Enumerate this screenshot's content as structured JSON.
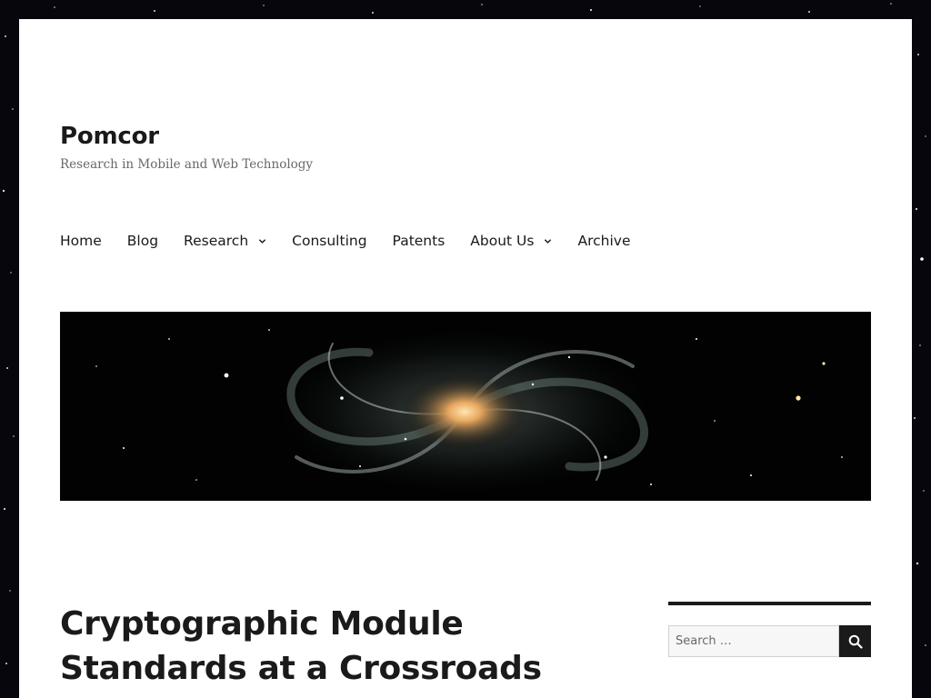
{
  "site": {
    "title": "Pomcor",
    "description": "Research in Mobile and Web Technology"
  },
  "nav": {
    "items": [
      {
        "label": "Home",
        "has_submenu": false
      },
      {
        "label": "Blog",
        "has_submenu": false
      },
      {
        "label": "Research",
        "has_submenu": true
      },
      {
        "label": "Consulting",
        "has_submenu": false
      },
      {
        "label": "Patents",
        "has_submenu": false
      },
      {
        "label": "About Us",
        "has_submenu": true
      },
      {
        "label": "Archive",
        "has_submenu": false
      }
    ]
  },
  "header_image": {
    "subject": "spiral galaxy"
  },
  "post": {
    "title": "Cryptographic Module Standards at a Crossroads"
  },
  "sidebar": {
    "search": {
      "placeholder": "Search …",
      "value": "",
      "button_icon": "search-icon"
    }
  },
  "colors": {
    "text": "#1a1a1a",
    "secondary_text": "#686868",
    "page_background": "#06060c",
    "content_background": "#ffffff"
  }
}
